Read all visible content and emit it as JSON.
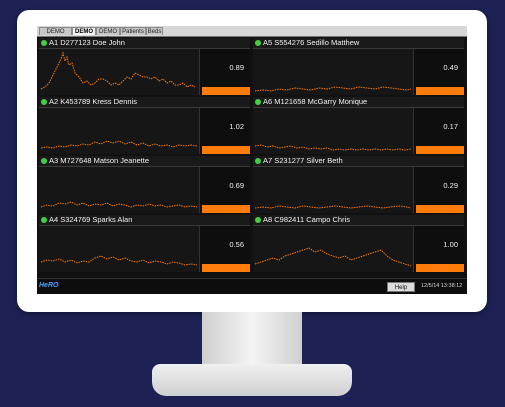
{
  "tabs": [
    {
      "label": "DEMO NICU",
      "active": false
    },
    {
      "label": "DEMO A",
      "active": true
    },
    {
      "label": "DEMO B",
      "active": false
    },
    {
      "label": "Patients",
      "active": false
    },
    {
      "label": "Beds",
      "active": false
    }
  ],
  "panels": [
    {
      "title": "A1  D277123 Doe John",
      "value": "0.89"
    },
    {
      "title": "A5  S554276 Sedillo Matthew",
      "value": "0.49"
    },
    {
      "title": "A2  K453789 Kress Dennis",
      "value": "1.02"
    },
    {
      "title": "A6  M121658 McGarry Monique",
      "value": "0.17"
    },
    {
      "title": "A3  M727648 Matson Jeanette",
      "value": "0.69"
    },
    {
      "title": "A7  S231277 Silver Beth",
      "value": "0.29"
    },
    {
      "title": "A4  S324769 Sparks Alan",
      "value": "0.56"
    },
    {
      "title": "A8  C982411 Campo Chris",
      "value": "1.00"
    }
  ],
  "footer": {
    "logo": "HeRO",
    "help_label": "Help",
    "timestamp": "12/5/14 13:38:12"
  },
  "colors": {
    "accent": "#ff7b0a",
    "status_ok": "#42d042",
    "background": "#1d2154"
  }
}
